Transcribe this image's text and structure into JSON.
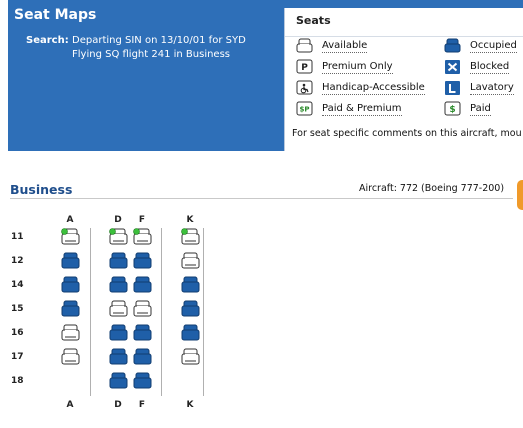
{
  "header": {
    "title": "Seat Maps",
    "search_label": "Search:",
    "search_line1": "Departing SIN on 13/10/01 for SYD",
    "search_line2": "Flying SQ flight 241 in Business"
  },
  "legend": {
    "title": "Seats",
    "items": [
      {
        "label": "Available",
        "icon": "available-seat-icon"
      },
      {
        "label": "Occupied",
        "icon": "occupied-seat-icon"
      },
      {
        "label": "Premium Only",
        "icon": "premium-seat-icon"
      },
      {
        "label": "Blocked",
        "icon": "blocked-seat-icon"
      },
      {
        "label": "Handicap-Accessible",
        "icon": "handicap-seat-icon"
      },
      {
        "label": "Lavatory",
        "icon": "lavatory-icon"
      },
      {
        "label": "Paid & Premium",
        "icon": "paid-premium-seat-icon"
      },
      {
        "label": "Paid",
        "icon": "paid-seat-icon"
      }
    ],
    "note": "For seat specific comments on this aircraft, mou"
  },
  "cabin": {
    "name": "Business",
    "aircraft": "Aircraft: 772 (Boeing 777-200)",
    "columns": [
      "A",
      "D",
      "F",
      "K"
    ],
    "rows": [
      {
        "label": "11",
        "seats": [
          "available-highlight",
          "available-highlight",
          "available-highlight",
          "available-highlight"
        ]
      },
      {
        "label": "12",
        "seats": [
          "occupied",
          "occupied",
          "occupied",
          "available"
        ]
      },
      {
        "label": "14",
        "seats": [
          "occupied",
          "occupied",
          "occupied",
          "occupied"
        ]
      },
      {
        "label": "15",
        "seats": [
          "occupied",
          "available",
          "available",
          "occupied"
        ]
      },
      {
        "label": "16",
        "seats": [
          "available",
          "occupied",
          "occupied",
          "occupied"
        ]
      },
      {
        "label": "17",
        "seats": [
          "available",
          "occupied",
          "occupied",
          "available"
        ]
      },
      {
        "label": "18",
        "seats": [
          "none",
          "occupied",
          "occupied",
          "none"
        ]
      }
    ]
  },
  "colors": {
    "header_bg": "#2e6fb8",
    "occupied": "#1f5fa8",
    "highlight_dot": "#3cc03c",
    "section_title": "#1f4e8c"
  }
}
